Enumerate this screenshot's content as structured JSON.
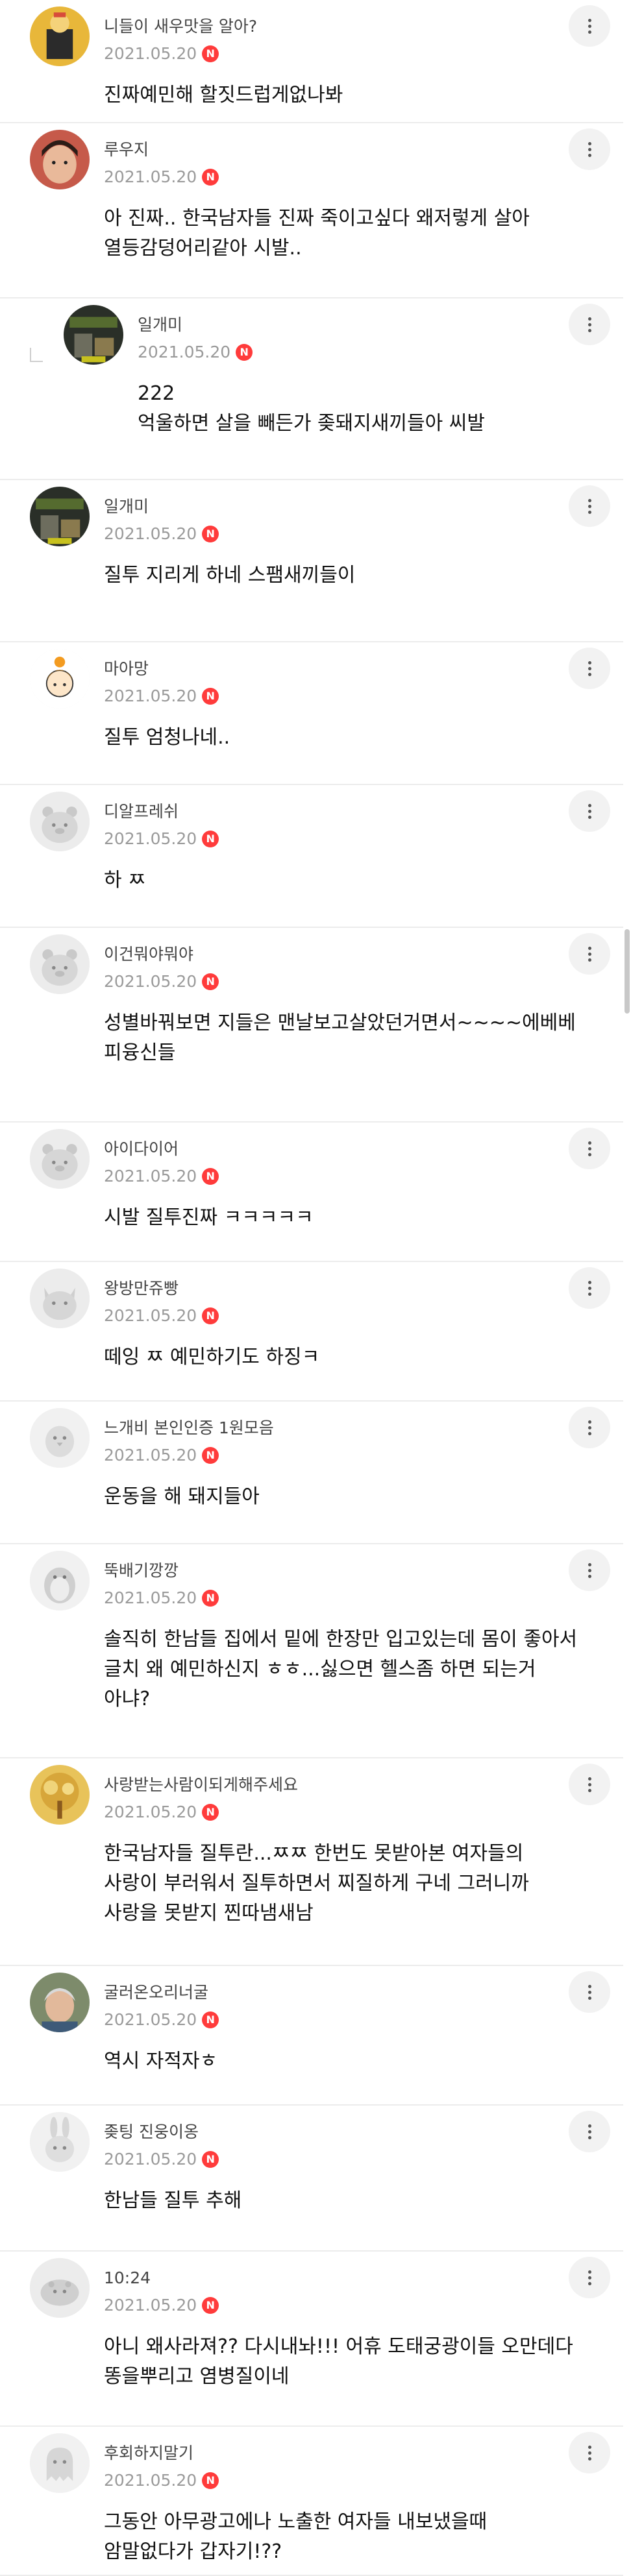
{
  "comments": [
    {
      "nickname": "니들이 새우맛을 알아?",
      "date": "2021.05.20",
      "new_badge": "N",
      "lines": [
        "진짜예민해 할짓드럽게없나봐"
      ],
      "avatar": "cartoon-photo"
    },
    {
      "nickname": "루우지",
      "date": "2021.05.20",
      "new_badge": "N",
      "lines": [
        "아 진짜.. 한국남자들 진짜 죽이고싶다 왜저렇게 살아",
        "열등감덩어리같아 시발.."
      ],
      "avatar": "child-photo"
    },
    {
      "nickname": "일개미",
      "date": "2021.05.20",
      "new_badge": "N",
      "lines": [
        "222",
        "억울하면 살을 빼든가 좆돼지새끼들아 씨발"
      ],
      "avatar": "dark-photo",
      "reply": true
    },
    {
      "nickname": "일개미",
      "date": "2021.05.20",
      "new_badge": "N",
      "lines": [
        "질투 지리게 하네 스팸새끼들이"
      ],
      "avatar": "dark-photo"
    },
    {
      "nickname": "마아망",
      "date": "2021.05.20",
      "new_badge": "N",
      "lines": [
        "질투 엄청나네.."
      ],
      "avatar": "girl-drawing"
    },
    {
      "nickname": "디알프레쉬",
      "date": "2021.05.20",
      "new_badge": "N",
      "lines": [
        "하 ㅉ"
      ],
      "avatar": "default-bear"
    },
    {
      "nickname": "이건뭐야뭐야",
      "date": "2021.05.20",
      "new_badge": "N",
      "lines": [
        "성별바꿔보면 지들은 맨날보고살았던거면서~~~~에베베",
        "피융신들"
      ],
      "avatar": "default-bear"
    },
    {
      "nickname": "아이다이어",
      "date": "2021.05.20",
      "new_badge": "N",
      "lines": [
        "시발 질투진짜 ㅋㅋㅋㅋㅋ"
      ],
      "avatar": "default-bear"
    },
    {
      "nickname": "왕방만쥬빵",
      "date": "2021.05.20",
      "new_badge": "N",
      "lines": [
        "떼잉 ㅉ 예민하기도 하징ㅋ"
      ],
      "avatar": "default-cat"
    },
    {
      "nickname": "느개비 본인인증 1원모음",
      "date": "2021.05.20",
      "new_badge": "N",
      "lines": [
        "운동을 해 돼지들아"
      ],
      "avatar": "default-chick"
    },
    {
      "nickname": "뚝배기깡깡",
      "date": "2021.05.20",
      "new_badge": "N",
      "lines": [
        "솔직히 한남들 집에서 밑에 한장만 입고있는데 몸이 좋아서",
        "글치 왜 예민하신지 ㅎㅎ...싫으면 헬스좀 하면 되는거",
        "아냐?"
      ],
      "avatar": "default-penguin"
    },
    {
      "nickname": "사랑받는사람이되게해주세요",
      "date": "2021.05.20",
      "new_badge": "N",
      "lines": [
        "한국남자들 질투란...ㅉㅉ 한번도 못받아본 여자들의",
        "사랑이 부러워서 질투하면서 찌질하게 구네 그러니까",
        "사랑을 못받지 찐따냄새남"
      ],
      "avatar": "gold-tree"
    },
    {
      "nickname": "굴러온오리너굴",
      "date": "2021.05.20",
      "new_badge": "N",
      "lines": [
        "역시 자적자ㅎ"
      ],
      "avatar": "grandma-photo"
    },
    {
      "nickname": "좆팅 진웅이옹",
      "date": "2021.05.20",
      "new_badge": "N",
      "lines": [
        "한남들 질투 추해"
      ],
      "avatar": "default-rabbit"
    },
    {
      "nickname": "10:24",
      "date": "2021.05.20",
      "new_badge": "N",
      "lines": [
        "아니 왜사라져?? 다시내놔!!! 어휴 도태궁광이들 오만데다",
        "똥을뿌리고 염병질이네"
      ],
      "avatar": "default-hippo"
    },
    {
      "nickname": "후회하지말기",
      "date": "2021.05.20",
      "new_badge": "N",
      "lines": [
        "그동안 아무광고에나 노출한 여자들 내보냈을때",
        "암말없다가 갑자기!??"
      ],
      "avatar": "default-ghost"
    }
  ],
  "colors": {
    "badge": "#ff3b3b",
    "divider": "#ececec",
    "meta": "#9a9a9a"
  }
}
